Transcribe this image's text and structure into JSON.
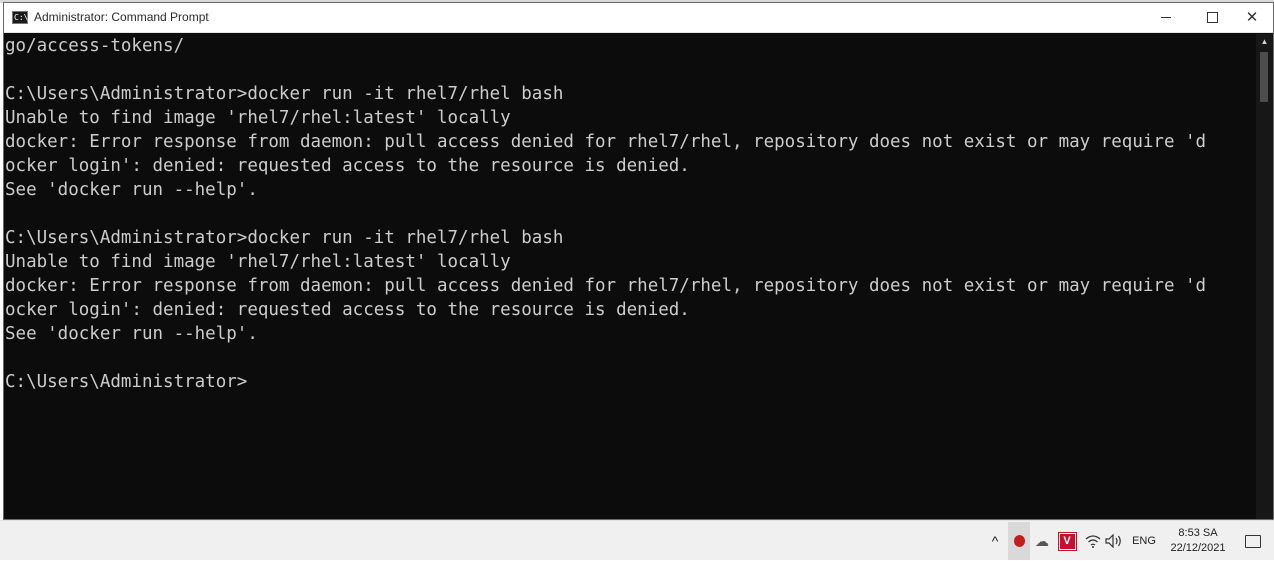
{
  "window": {
    "title": "Administrator: Command Prompt",
    "icon_label": "C:\\",
    "minimize_icon": "minimize-icon",
    "maximize_icon": "maximize-icon",
    "close_glyph": "✕"
  },
  "console": {
    "lines": [
      "go/access-tokens/",
      "",
      "C:\\Users\\Administrator>docker run -it rhel7/rhel bash",
      "Unable to find image 'rhel7/rhel:latest' locally",
      "docker: Error response from daemon: pull access denied for rhel7/rhel, repository does not exist or may require 'd",
      "ocker login': denied: requested access to the resource is denied.",
      "See 'docker run --help'.",
      "",
      "C:\\Users\\Administrator>docker run -it rhel7/rhel bash",
      "Unable to find image 'rhel7/rhel:latest' locally",
      "docker: Error response from daemon: pull access denied for rhel7/rhel, repository does not exist or may require 'd",
      "ocker login': denied: requested access to the resource is denied.",
      "See 'docker run --help'.",
      "",
      "C:\\Users\\Administrator>"
    ],
    "text_color": "#cccccc",
    "background": "#0c0c0c"
  },
  "taskbar": {
    "chevron": "^",
    "language": "ENG",
    "time": "8:53 SA",
    "date": "22/12/2021",
    "tray_icons": [
      "bug-icon",
      "docker-icon",
      "vivaldi-icon",
      "wifi-icon",
      "volume-icon",
      "notification-icon"
    ],
    "vivaldi_letter": "V"
  }
}
